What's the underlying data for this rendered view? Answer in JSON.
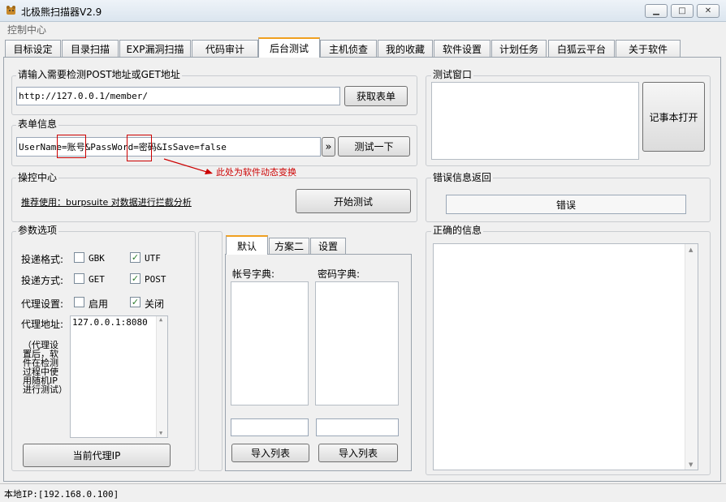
{
  "window": {
    "title": "北极熊扫描器V2.9",
    "menu": "控制中心"
  },
  "tabs": [
    "目标设定",
    "目录扫描",
    "EXP漏洞扫描",
    "代码审计",
    "后台测试",
    "主机侦查",
    "我的收藏",
    "软件设置",
    "计划任务",
    "白狐云平台",
    "关于软件"
  ],
  "url_group": {
    "title": "请输入需要检测POST地址或GET地址",
    "url_value": "http://127.0.0.1/member/",
    "fetch_button": "获取表单"
  },
  "form_group": {
    "title": "表单信息",
    "form_value": "UserName=账号&PassWord=密码&IsSave=false",
    "expand_button": "»",
    "test_button": "测试一下",
    "annotation": "此处为软件动态变换"
  },
  "control_group": {
    "title": "操控中心",
    "hint": "推荐使用：burpsuite 对数据进行拦截分析",
    "start_button": "开始测试"
  },
  "params_group": {
    "title": "参数选项",
    "format_label": "投递格式:",
    "gbk": "GBK",
    "utf": "UTF",
    "method_label": "投递方式:",
    "get": "GET",
    "post": "POST",
    "proxy_label": "代理设置:",
    "enable": "启用",
    "disable": "关闭",
    "proxy_addr_label": "代理地址:",
    "proxy_note": "（代理设置后，软件在检测过程中使用随机IP进行测试）",
    "proxy_list": "127.0.0.1:8080",
    "current_proxy_button": "当前代理IP",
    "checked": {
      "gbk": false,
      "utf": true,
      "get": false,
      "post": true,
      "enable": false,
      "disable": true
    }
  },
  "dict_panel": {
    "tabs": [
      "默认",
      "方案二",
      "设置"
    ],
    "user_dict_label": "帐号字典:",
    "pass_dict_label": "密码字典:",
    "import_user_button": "导入列表",
    "import_pass_button": "导入列表"
  },
  "test_window": {
    "title": "测试窗口",
    "notepad_button": "记事本打开"
  },
  "error_group": {
    "title": "错误信息返回",
    "error_value": "错误"
  },
  "correct_group": {
    "title": "正确的信息"
  },
  "statusbar": {
    "local_ip": "本地IP:[192.168.0.100]"
  }
}
